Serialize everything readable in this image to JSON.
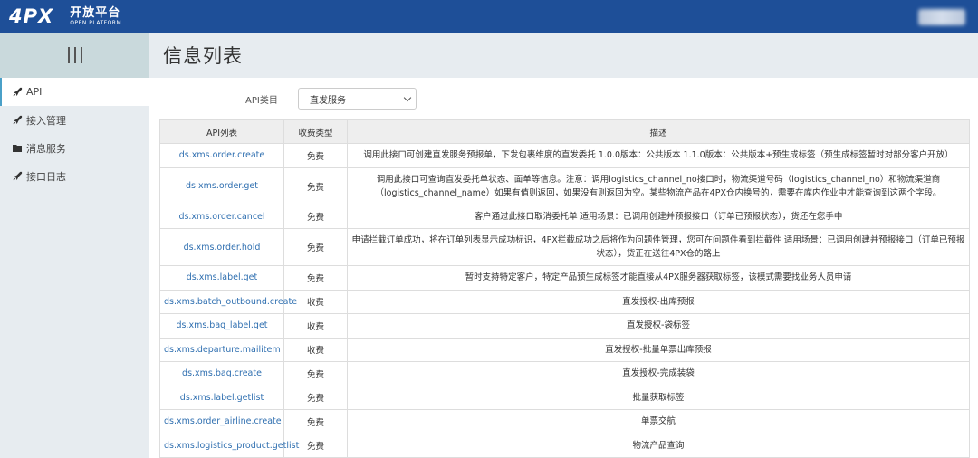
{
  "header": {
    "logo_mark": "4PX",
    "logo_cn": "开放平台",
    "logo_en": "OPEN PLATFORM"
  },
  "sidebar": {
    "items": [
      {
        "label": "API",
        "icon": "rocket-icon",
        "active": true
      },
      {
        "label": "接入管理",
        "icon": "rocket-icon",
        "active": false
      },
      {
        "label": "消息服务",
        "icon": "folder-icon",
        "active": false
      },
      {
        "label": "接口日志",
        "icon": "rocket-icon",
        "active": false
      }
    ]
  },
  "main": {
    "title": "信息列表",
    "filter": {
      "label": "API类目",
      "selected": "直发服务"
    },
    "table": {
      "headers": [
        "API列表",
        "收费类型",
        "描述"
      ],
      "rows": [
        {
          "api": "ds.xms.order.create",
          "fee": "免费",
          "desc": "调用此接口可创建直发服务预报单，下发包裹维度的直发委托 1.0.0版本：公共版本 1.1.0版本：公共版本+预生成标签（预生成标签暂时对部分客户开放）"
        },
        {
          "api": "ds.xms.order.get",
          "fee": "免费",
          "desc": "调用此接口可查询直发委托单状态、面单等信息。注意：调用logistics_channel_no接口时，物流渠道号码（logistics_channel_no）和物流渠道商（logistics_channel_name）如果有值则返回，如果没有则返回为空。某些物流产品在4PX仓内换号的，需要在库内作业中才能查询到这两个字段。"
        },
        {
          "api": "ds.xms.order.cancel",
          "fee": "免费",
          "desc": "客户通过此接口取消委托单 适用场景：已调用创建并预报接口（订单已预报状态），货还在您手中"
        },
        {
          "api": "ds.xms.order.hold",
          "fee": "免费",
          "desc": "申请拦截订单成功，将在订单列表显示成功标识，4PX拦截成功之后将作为问题件管理，您可在问题件看到拦截件 适用场景：已调用创建并预报接口（订单已预报状态），货正在送往4PX仓的路上"
        },
        {
          "api": "ds.xms.label.get",
          "fee": "免费",
          "desc": "暂时支持特定客户，特定产品预生成标签才能直接从4PX服务器获取标签，该模式需要找业务人员申请"
        },
        {
          "api": "ds.xms.batch_outbound.create",
          "fee": "收费",
          "desc": "直发授权-出库预报"
        },
        {
          "api": "ds.xms.bag_label.get",
          "fee": "收费",
          "desc": "直发授权-袋标签"
        },
        {
          "api": "ds.xms.departure.mailitem",
          "fee": "收费",
          "desc": "直发授权-批量单票出库预报"
        },
        {
          "api": "ds.xms.bag.create",
          "fee": "免费",
          "desc": "直发授权-完成装袋"
        },
        {
          "api": "ds.xms.label.getlist",
          "fee": "免费",
          "desc": "批量获取标签"
        },
        {
          "api": "ds.xms.order_airline.create",
          "fee": "免费",
          "desc": "单票交航"
        },
        {
          "api": "ds.xms.logistics_product.getlist",
          "fee": "免费",
          "desc": "物流产品查询"
        }
      ]
    }
  },
  "colors": {
    "header_bg": "#1e4f98",
    "sidebar_bg": "#e7ecf0",
    "link": "#2f6fb0",
    "active_indicator": "#4aa0c8"
  }
}
